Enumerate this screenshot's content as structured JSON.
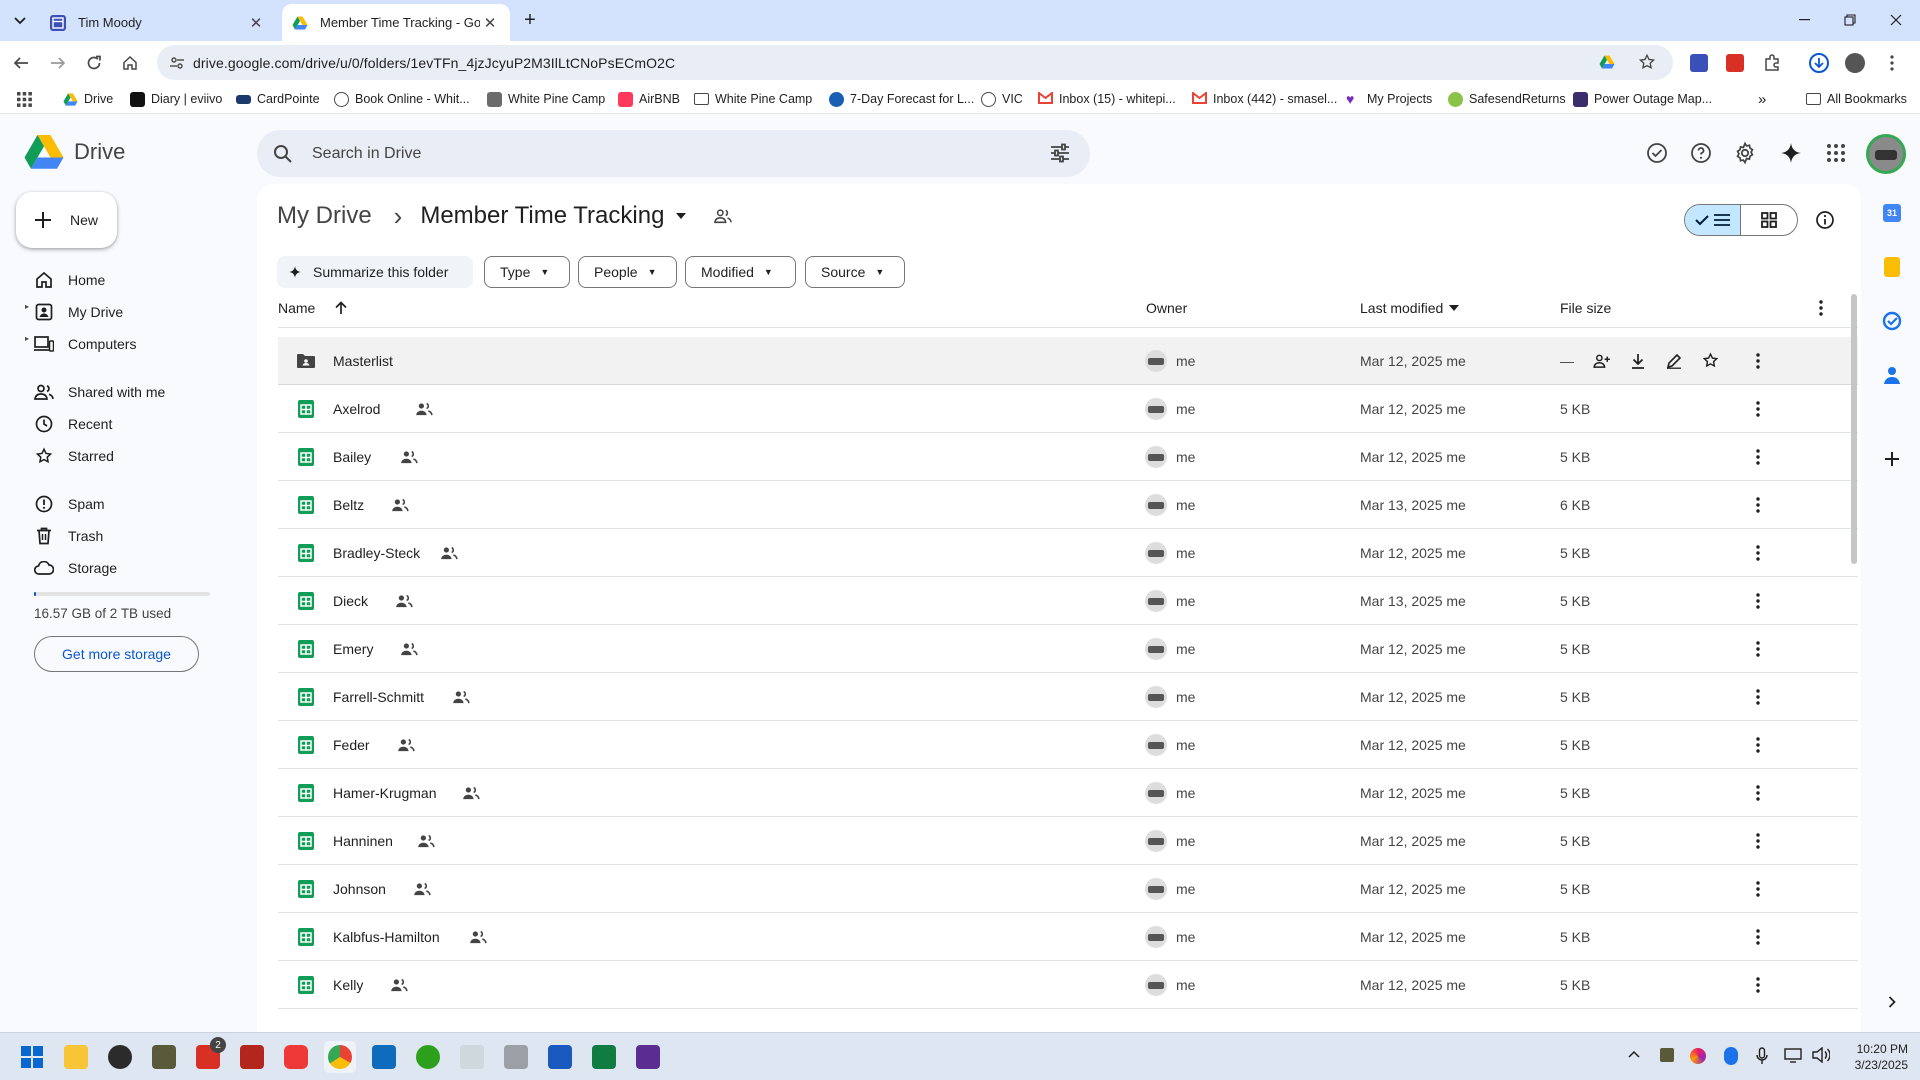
{
  "browser": {
    "tabs": [
      {
        "title": "Tim Moody"
      },
      {
        "title": "Member Time Tracking - Googl"
      }
    ],
    "url": "drive.google.com/drive/u/0/folders/1evTFn_4jzJcyuP2M3IlLtCNoPsECmO2C",
    "bookmarks": [
      {
        "label": "Drive"
      },
      {
        "label": "Diary | eviivo"
      },
      {
        "label": "CardPointe"
      },
      {
        "label": "Book Online - Whit..."
      },
      {
        "label": "White Pine Camp"
      },
      {
        "label": "AirBNB"
      },
      {
        "label": "White Pine Camp"
      },
      {
        "label": "7-Day Forecast for L..."
      },
      {
        "label": "VIC"
      },
      {
        "label": "Inbox (15) - whitepi..."
      },
      {
        "label": "Inbox (442) - smasel..."
      },
      {
        "label": "My Projects"
      },
      {
        "label": "SafesendReturns"
      },
      {
        "label": "Power Outage Map..."
      }
    ],
    "all_bookmarks": "All Bookmarks"
  },
  "drive": {
    "logo_text": "Drive",
    "search_placeholder": "Search in Drive",
    "new_label": "New",
    "nav": {
      "home": "Home",
      "my_drive": "My Drive",
      "computers": "Computers",
      "shared": "Shared with me",
      "recent": "Recent",
      "starred": "Starred",
      "spam": "Spam",
      "trash": "Trash",
      "storage": "Storage"
    },
    "storage_used": "16.57 GB of 2 TB used",
    "storage_fraction": 0.008,
    "get_storage": "Get more storage",
    "breadcrumb_root": "My Drive",
    "breadcrumb_sep": "›",
    "folder_title": "Member Time Tracking",
    "summarize": "Summarize this folder",
    "filters": [
      "Type",
      "People",
      "Modified",
      "Source"
    ],
    "columns": {
      "name": "Name",
      "owner": "Owner",
      "modified": "Last modified",
      "size": "File size"
    },
    "files": [
      {
        "name": "Masterlist",
        "kind": "folder",
        "shared": false,
        "owner": "me",
        "modified": "Mar 12, 2025 me",
        "size": "—"
      },
      {
        "name": "Axelrod",
        "kind": "sheet",
        "shared": true,
        "owner": "me",
        "modified": "Mar 12, 2025 me",
        "size": "5 KB"
      },
      {
        "name": "Bailey",
        "kind": "sheet",
        "shared": true,
        "owner": "me",
        "modified": "Mar 12, 2025 me",
        "size": "5 KB"
      },
      {
        "name": "Beltz",
        "kind": "sheet",
        "shared": true,
        "owner": "me",
        "modified": "Mar 13, 2025 me",
        "size": "6 KB"
      },
      {
        "name": "Bradley-Steck",
        "kind": "sheet",
        "shared": true,
        "owner": "me",
        "modified": "Mar 12, 2025 me",
        "size": "5 KB"
      },
      {
        "name": "Dieck",
        "kind": "sheet",
        "shared": true,
        "owner": "me",
        "modified": "Mar 13, 2025 me",
        "size": "5 KB"
      },
      {
        "name": "Emery",
        "kind": "sheet",
        "shared": true,
        "owner": "me",
        "modified": "Mar 12, 2025 me",
        "size": "5 KB"
      },
      {
        "name": "Farrell-Schmitt",
        "kind": "sheet",
        "shared": true,
        "owner": "me",
        "modified": "Mar 12, 2025 me",
        "size": "5 KB"
      },
      {
        "name": "Feder",
        "kind": "sheet",
        "shared": true,
        "owner": "me",
        "modified": "Mar 12, 2025 me",
        "size": "5 KB"
      },
      {
        "name": "Hamer-Krugman",
        "kind": "sheet",
        "shared": true,
        "owner": "me",
        "modified": "Mar 12, 2025 me",
        "size": "5 KB"
      },
      {
        "name": "Hanninen",
        "kind": "sheet",
        "shared": true,
        "owner": "me",
        "modified": "Mar 12, 2025 me",
        "size": "5 KB"
      },
      {
        "name": "Johnson",
        "kind": "sheet",
        "shared": true,
        "owner": "me",
        "modified": "Mar 12, 2025 me",
        "size": "5 KB"
      },
      {
        "name": "Kalbfus-Hamilton",
        "kind": "sheet",
        "shared": true,
        "owner": "me",
        "modified": "Mar 12, 2025 me",
        "size": "5 KB"
      },
      {
        "name": "Kelly",
        "kind": "sheet",
        "shared": true,
        "owner": "me",
        "modified": "Mar 12, 2025 me",
        "size": "5 KB"
      }
    ]
  },
  "taskbar": {
    "time": "10:20 PM",
    "date": "3/23/2025",
    "badge": "2"
  },
  "colors": {
    "accent": "#0b57d0",
    "sheet_green": "#0f9d58",
    "tab_strip": "#d3e3fd",
    "selected_view": "#c2e7ff"
  }
}
